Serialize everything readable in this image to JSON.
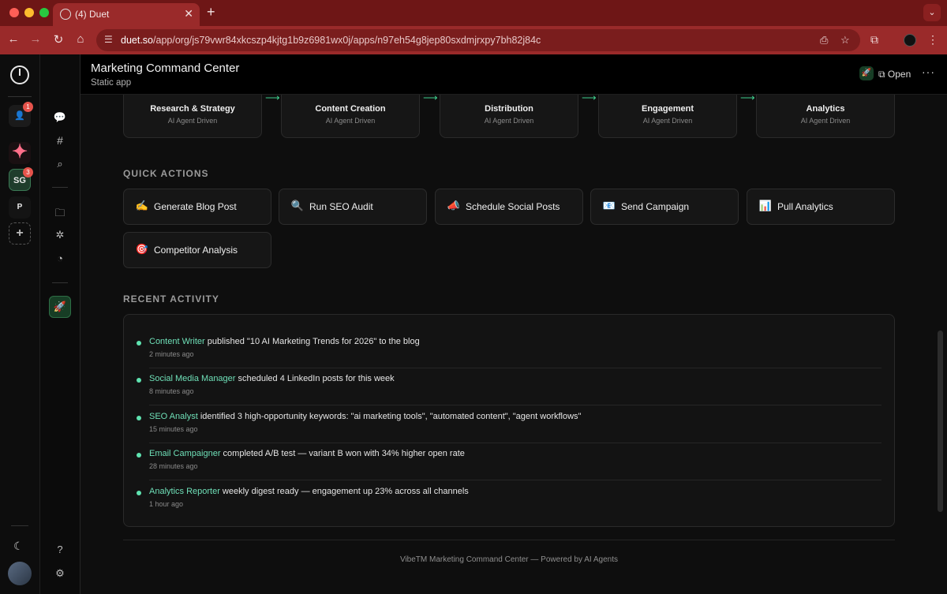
{
  "browser": {
    "tab_title": "(4) Duet",
    "url_host": "duet.so",
    "url_path": "/app/org/js79vwr84xkcszp4kjtg1b9z6981wx0j/apps/n97eh54g8jep80sxdmjrxpy7bh82j84c"
  },
  "workspaces": [
    {
      "label": "",
      "badge": "1"
    },
    {
      "label": "SG",
      "badge": "3"
    },
    {
      "label": "P",
      "badge": ""
    }
  ],
  "header": {
    "title": "Marketing Command Center",
    "subtitle": "Static app",
    "open_label": "Open"
  },
  "pipeline": [
    {
      "name": "Research & Strategy",
      "sub": "AI Agent Driven"
    },
    {
      "name": "Content Creation",
      "sub": "AI Agent Driven"
    },
    {
      "name": "Distribution",
      "sub": "AI Agent Driven"
    },
    {
      "name": "Engagement",
      "sub": "AI Agent Driven"
    },
    {
      "name": "Analytics",
      "sub": "AI Agent Driven"
    }
  ],
  "quick_actions_label": "QUICK ACTIONS",
  "quick_actions": [
    {
      "icon": "✍",
      "label": "Generate Blog Post"
    },
    {
      "icon": "🔍",
      "label": "Run SEO Audit"
    },
    {
      "icon": "📣",
      "label": "Schedule Social Posts"
    },
    {
      "icon": "📧",
      "label": "Send Campaign"
    },
    {
      "icon": "📊",
      "label": "Pull Analytics"
    },
    {
      "icon": "🎯",
      "label": "Competitor Analysis"
    }
  ],
  "recent_activity_label": "RECENT ACTIVITY",
  "activity": [
    {
      "agent": "Content Writer",
      "text": " published \"10 AI Marketing Trends for 2026\" to the blog",
      "time": "2 minutes ago"
    },
    {
      "agent": "Social Media Manager",
      "text": " scheduled 4 LinkedIn posts for this week",
      "time": "8 minutes ago"
    },
    {
      "agent": "SEO Analyst",
      "text": " identified 3 high-opportunity keywords: \"ai marketing tools\", \"automated content\", \"agent workflows\"",
      "time": "15 minutes ago"
    },
    {
      "agent": "Email Campaigner",
      "text": " completed A/B test — variant B won with 34% higher open rate",
      "time": "28 minutes ago"
    },
    {
      "agent": "Analytics Reporter",
      "text": " weekly digest ready — engagement up 23% across all channels",
      "time": "1 hour ago"
    }
  ],
  "footer": "VibeTM Marketing Command Center — Powered by AI Agents",
  "colors": {
    "accent": "#5fe3b0",
    "browser_frame": "#9a2a2a",
    "background": "#0e0e0e"
  }
}
